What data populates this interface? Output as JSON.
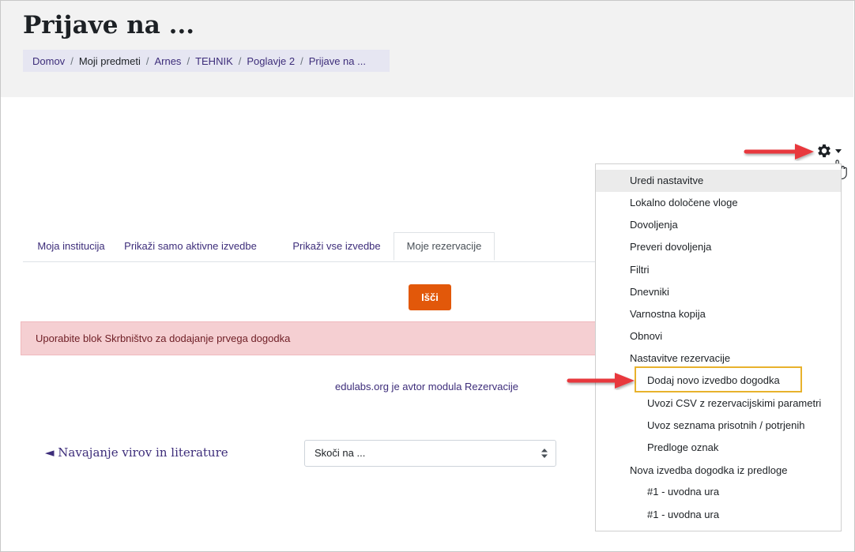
{
  "page": {
    "title": "Prijave na ..."
  },
  "breadcrumb": [
    {
      "label": "Domov",
      "current": false
    },
    {
      "label": "Moji predmeti",
      "current": true
    },
    {
      "label": "Arnes",
      "current": false
    },
    {
      "label": "TEHNIK",
      "current": false
    },
    {
      "label": "Poglavje 2",
      "current": false
    },
    {
      "label": "Prijave na ...",
      "current": false
    }
  ],
  "breadcrumb_separator": "/",
  "tabs": [
    {
      "label": "Moja institucija",
      "active": false
    },
    {
      "label": "Prikaži samo aktivne izvedbe",
      "active": false
    },
    {
      "label": "Prikaži vse izvedbe",
      "active": false
    },
    {
      "label": "Moje rezervacije",
      "active": true
    }
  ],
  "search_button": "Išči",
  "alert": "Uporabite blok Skrbništvo za dodajanje prvega dogodka",
  "credit": "edulabs.org je avtor modula Rezervacije",
  "prev_link": "◄ Navajanje virov in literature",
  "jump_select": {
    "value": "Skoči na ..."
  },
  "actions_menu": {
    "icon": "gear-icon",
    "items": [
      {
        "label": "Uredi nastavitve",
        "level": 0,
        "highlight": true
      },
      {
        "label": "Lokalno določene vloge",
        "level": 0
      },
      {
        "label": "Dovoljenja",
        "level": 0
      },
      {
        "label": "Preveri dovoljenja",
        "level": 0
      },
      {
        "label": "Filtri",
        "level": 0
      },
      {
        "label": "Dnevniki",
        "level": 0
      },
      {
        "label": "Varnostna kopija",
        "level": 0
      },
      {
        "label": "Obnovi",
        "level": 0
      },
      {
        "label": "Nastavitve rezervacije",
        "level": 0
      },
      {
        "label": "Dodaj novo izvedbo dogodka",
        "level": 1,
        "boxed": true
      },
      {
        "label": "Uvozi CSV z rezervacijskimi parametri",
        "level": 1
      },
      {
        "label": "Uvoz seznama prisotnih / potrjenih",
        "level": 1
      },
      {
        "label": "Predloge oznak",
        "level": 1
      },
      {
        "label": "Nova izvedba dogodka iz predloge",
        "level": 0
      },
      {
        "label": "#1 - uvodna ura",
        "level": 1
      },
      {
        "label": "#1 - uvodna ura",
        "level": 1
      }
    ]
  },
  "colors": {
    "accent": "#3d2d7a",
    "button": "#e2580a",
    "annotation_arrow": "#e8383d",
    "highlight_box": "#e8b22c"
  }
}
